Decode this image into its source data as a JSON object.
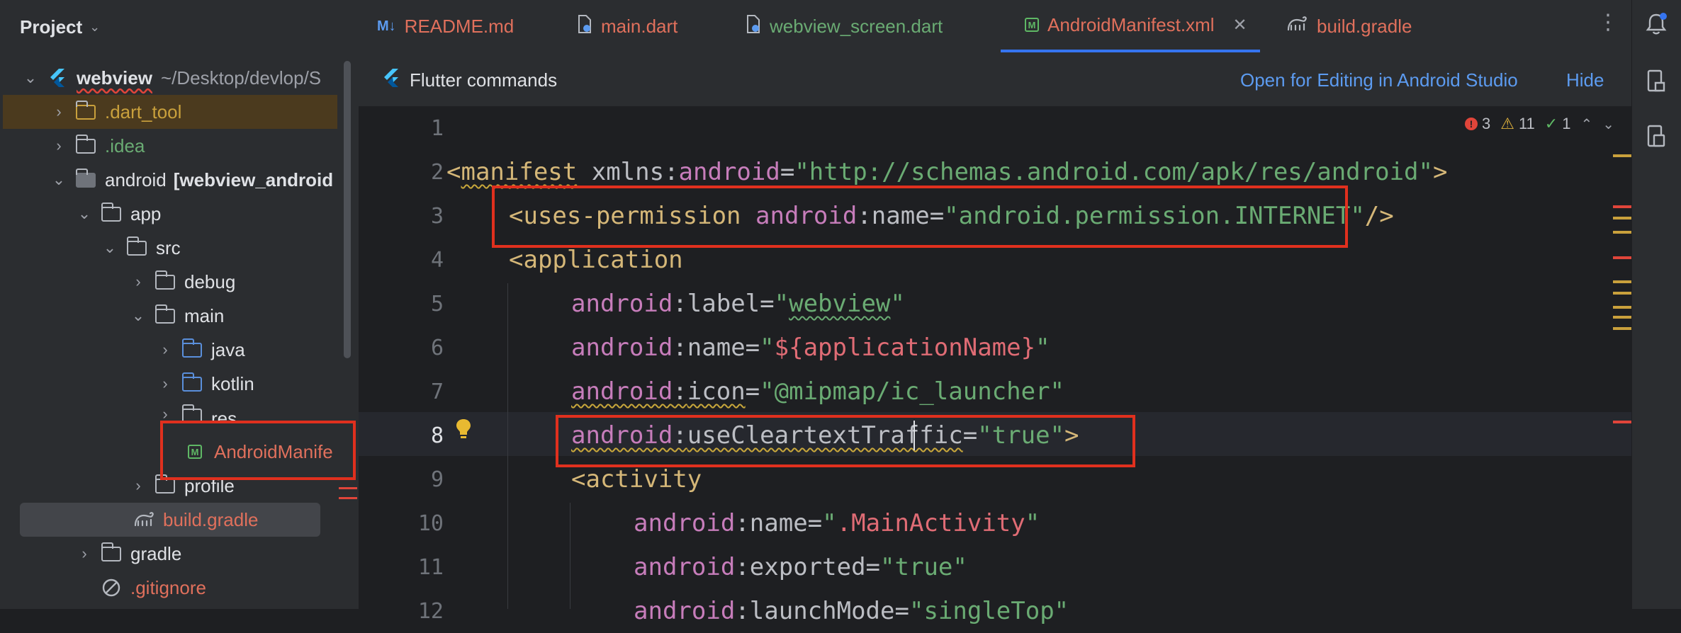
{
  "project_panel": {
    "title": "Project",
    "root": {
      "name": "webview",
      "path": "~/Desktop/devlop/S"
    },
    "items": [
      {
        "label": ".dart_tool",
        "color": "#c9a03c"
      },
      {
        "label": ".idea",
        "color": "#6aab73"
      },
      {
        "label": "android",
        "suffix": "[webview_android",
        "color": "#dfe1e5"
      },
      {
        "label": "app",
        "color": "#dfe1e5"
      },
      {
        "label": "src",
        "color": "#dfe1e5"
      },
      {
        "label": "debug",
        "color": "#dfe1e5"
      },
      {
        "label": "main",
        "color": "#dfe1e5"
      },
      {
        "label": "java",
        "color": "#dfe1e5"
      },
      {
        "label": "kotlin",
        "color": "#dfe1e5"
      },
      {
        "label": "res",
        "color": "#dfe1e5"
      },
      {
        "label": "AndroidManife",
        "color": "#e0705c"
      },
      {
        "label": "profile",
        "color": "#dfe1e5"
      },
      {
        "label": "build.gradle",
        "color": "#e0705c"
      },
      {
        "label": "gradle",
        "color": "#dfe1e5"
      },
      {
        "label": ".gitignore",
        "color": "#e0705c"
      }
    ]
  },
  "tabs": [
    {
      "label": "README.md",
      "icon": "markdown-icon",
      "color": "#e0705c"
    },
    {
      "label": "main.dart",
      "icon": "dart-file-icon",
      "color": "#e0705c"
    },
    {
      "label": "webview_screen.dart",
      "icon": "dart-file-icon",
      "color": "#6aab73"
    },
    {
      "label": "AndroidManifest.xml",
      "icon": "manifest-icon",
      "color": "#e0705c",
      "active": true
    },
    {
      "label": "build.gradle",
      "icon": "gradle-icon",
      "color": "#e0705c"
    }
  ],
  "banner": {
    "title": "Flutter commands",
    "open_link": "Open for Editing in Android Studio",
    "hide_link": "Hide"
  },
  "inspections": {
    "errors": "3",
    "warnings": "11",
    "ok": "1"
  },
  "line_numbers": [
    "1",
    "2",
    "3",
    "4",
    "5",
    "6",
    "7",
    "8",
    "9",
    "10",
    "11",
    "12"
  ],
  "current_line": "8",
  "code": {
    "l2": {
      "open": "<",
      "tag": "manifest",
      "attr": " xmlns:",
      "ns": "android",
      "eq": "=",
      "value": "\"http://schemas.android.com/apk/res/android\"",
      "close": ">"
    },
    "l3": {
      "open": "<",
      "tag": "uses-permission",
      "ns": "android",
      "attr": "name",
      "eq": "=",
      "value": "\"android.permission.INTERNET\"",
      "close": "/>"
    },
    "l4": {
      "open": "<",
      "tag": "application"
    },
    "l5": {
      "ns": "android",
      "attr": "label",
      "eq": "=",
      "q1": "\"",
      "value": "webview",
      "q2": "\""
    },
    "l6": {
      "ns": "android",
      "attr": "name",
      "eq": "=",
      "q1": "\"",
      "value": "${applicationName}",
      "q2": "\""
    },
    "l7": {
      "ns": "android",
      "attr": "icon",
      "eq": "=",
      "value": "\"@mipmap/ic_launcher\""
    },
    "l8": {
      "ns": "android",
      "attr": "useCleartextTraffic",
      "eq": "=",
      "value": "\"true\"",
      "close": ">"
    },
    "l9": {
      "open": "<",
      "tag": "activity"
    },
    "l10": {
      "ns": "android",
      "attr": "name",
      "eq": "=",
      "q1": "\"",
      "value": ".MainActivity",
      "q2": "\""
    },
    "l11": {
      "ns": "android",
      "attr": "exported",
      "eq": "=",
      "value": "\"true\""
    },
    "l12": {
      "ns": "android",
      "attr": "launchMode",
      "eq": "=",
      "value": "\"singleTop\""
    }
  },
  "colors": {
    "accent": "#3574f0",
    "highlight_box": "#e0301e"
  }
}
